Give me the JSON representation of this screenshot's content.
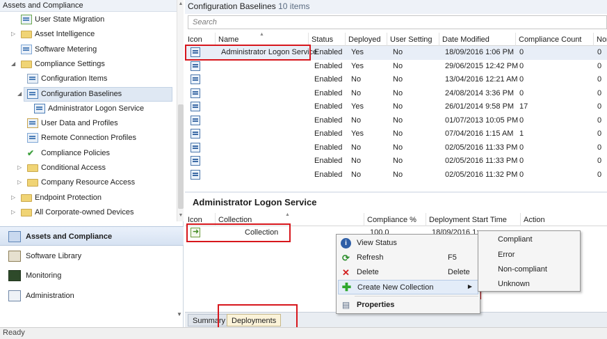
{
  "nav": {
    "header": "Assets and Compliance",
    "tree": [
      {
        "label": "User State Migration",
        "icon": "user-migration-icon",
        "arrow": ""
      },
      {
        "label": "Asset Intelligence",
        "icon": "folder-icon",
        "arrow": "▷"
      },
      {
        "label": "Software Metering",
        "icon": "software-metering-icon",
        "arrow": ""
      },
      {
        "label": "Compliance Settings",
        "icon": "folder-icon",
        "arrow": "◢"
      },
      {
        "label": "Configuration Items",
        "icon": "configuration-item-icon",
        "arrow": ""
      },
      {
        "label": "Configuration Baselines",
        "icon": "configuration-baseline-icon",
        "arrow": "◢"
      },
      {
        "label": "Administrator Logon Service",
        "icon": "baseline-icon",
        "arrow": ""
      },
      {
        "label": "User Data and Profiles",
        "icon": "user-data-icon",
        "arrow": ""
      },
      {
        "label": "Remote Connection Profiles",
        "icon": "remote-connection-icon",
        "arrow": ""
      },
      {
        "label": "Compliance Policies",
        "icon": "compliance-policy-icon",
        "arrow": ""
      },
      {
        "label": "Conditional Access",
        "icon": "folder-icon",
        "arrow": "▷"
      },
      {
        "label": "Company Resource Access",
        "icon": "folder-icon",
        "arrow": "▷"
      },
      {
        "label": "Endpoint Protection",
        "icon": "folder-icon",
        "arrow": "▷"
      },
      {
        "label": "All Corporate-owned Devices",
        "icon": "folder-icon",
        "arrow": "▷"
      }
    ],
    "workspaces": [
      {
        "label": "Assets and Compliance",
        "icon": "assets-compliance-icon",
        "active": true
      },
      {
        "label": "Software Library",
        "icon": "software-library-icon",
        "active": false
      },
      {
        "label": "Monitoring",
        "icon": "monitoring-icon",
        "active": false
      },
      {
        "label": "Administration",
        "icon": "administration-icon",
        "active": false
      }
    ]
  },
  "list": {
    "title": "Configuration Baselines",
    "count": "10 items",
    "search_placeholder": "Search",
    "columns": [
      "Icon",
      "Name",
      "Status",
      "Deployed",
      "User Setting",
      "Date Modified",
      "Compliance Count",
      "Non"
    ],
    "rows": [
      {
        "name": "Administrator Logon Service",
        "status": "Enabled",
        "deployed": "Yes",
        "user_setting": "No",
        "date": "18/09/2016 1:06 PM",
        "compliance": "0",
        "non": "0"
      },
      {
        "name": "",
        "status": "Enabled",
        "deployed": "Yes",
        "user_setting": "No",
        "date": "29/06/2015 12:42 PM",
        "compliance": "0",
        "non": "0"
      },
      {
        "name": "",
        "status": "Enabled",
        "deployed": "No",
        "user_setting": "No",
        "date": "13/04/2016 12:21 AM",
        "compliance": "0",
        "non": "0"
      },
      {
        "name": "",
        "status": "Enabled",
        "deployed": "No",
        "user_setting": "No",
        "date": "24/08/2014 3:36 PM",
        "compliance": "0",
        "non": "0"
      },
      {
        "name": "",
        "status": "Enabled",
        "deployed": "Yes",
        "user_setting": "No",
        "date": "26/01/2014 9:58 PM",
        "compliance": "17",
        "non": "0"
      },
      {
        "name": "",
        "status": "Enabled",
        "deployed": "No",
        "user_setting": "No",
        "date": "01/07/2013 10:05 PM",
        "compliance": "0",
        "non": "0"
      },
      {
        "name": "",
        "status": "Enabled",
        "deployed": "Yes",
        "user_setting": "No",
        "date": "07/04/2016 1:15 AM",
        "compliance": "1",
        "non": "0"
      },
      {
        "name": "",
        "status": "Enabled",
        "deployed": "No",
        "user_setting": "No",
        "date": "02/05/2016 11:33 PM",
        "compliance": "0",
        "non": "0"
      },
      {
        "name": "",
        "status": "Enabled",
        "deployed": "No",
        "user_setting": "No",
        "date": "02/05/2016 11:33 PM",
        "compliance": "0",
        "non": "0"
      },
      {
        "name": "",
        "status": "Enabled",
        "deployed": "No",
        "user_setting": "No",
        "date": "02/05/2016 11:32 PM",
        "compliance": "0",
        "non": "0"
      }
    ]
  },
  "details": {
    "title": "Administrator Logon Service",
    "columns": [
      "Icon",
      "Collection",
      "Compliance %",
      "Deployment Start Time",
      "Action"
    ],
    "row": {
      "collection": "Collection",
      "compliance": "100.0",
      "start_time": "18/09/2016 1:"
    }
  },
  "tabs": [
    "Summary",
    "Deployments"
  ],
  "context_menu": {
    "items": [
      {
        "label": "View Status",
        "icon": "info-icon",
        "shortcut": ""
      },
      {
        "label": "Refresh",
        "icon": "refresh-icon",
        "shortcut": "F5"
      },
      {
        "label": "Delete",
        "icon": "delete-icon",
        "shortcut": "Delete"
      },
      {
        "label": "Create New Collection",
        "icon": "add-icon",
        "shortcut": ""
      },
      {
        "label": "Properties",
        "icon": "properties-icon",
        "shortcut": ""
      }
    ],
    "submenu": [
      "Compliant",
      "Error",
      "Non-compliant",
      "Unknown"
    ]
  },
  "status": {
    "text": "Ready"
  },
  "colors": {
    "highlight": "#d7161c",
    "selection": "#dfe8f3",
    "active_tab": "#fbf3d9"
  }
}
